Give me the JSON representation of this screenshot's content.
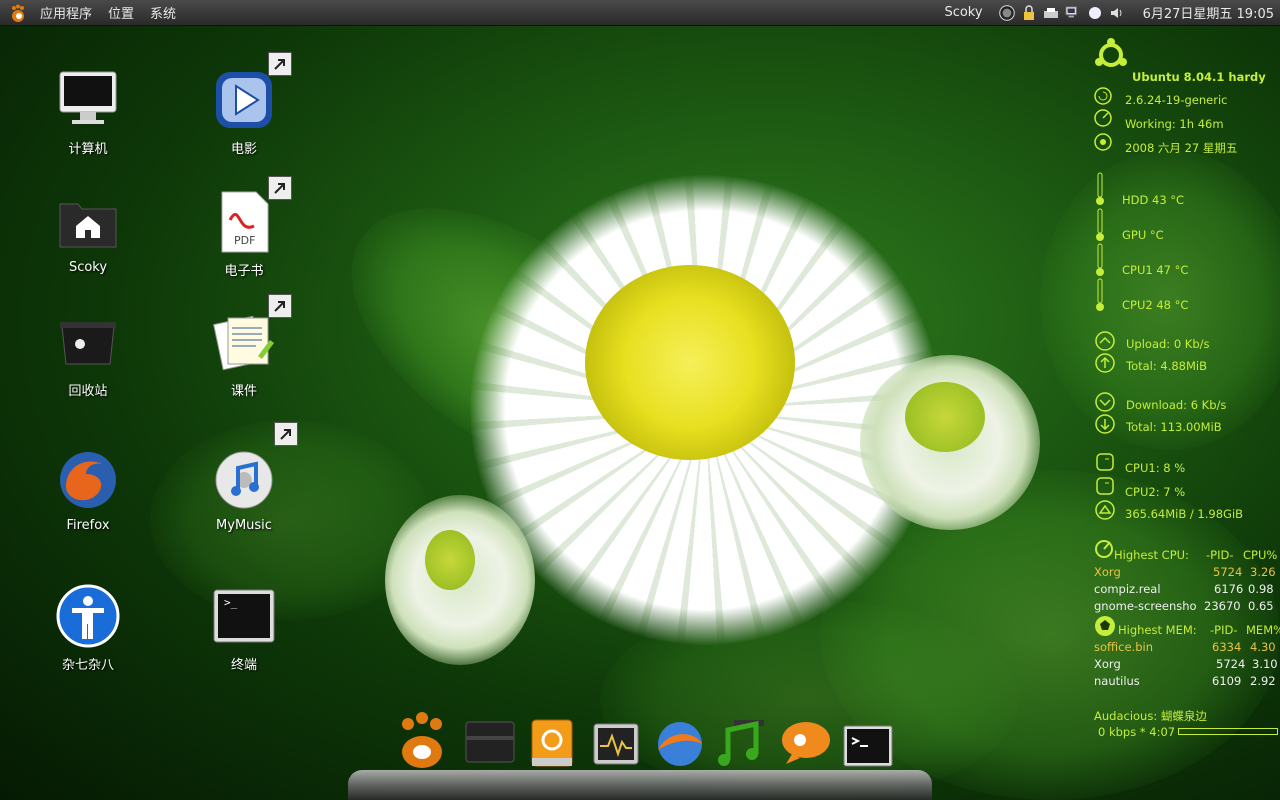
{
  "panel": {
    "menus": [
      "应用程序",
      "位置",
      "系统"
    ],
    "user": "Scoky",
    "clock": "6月27日星期五 19:05"
  },
  "desktop": {
    "icons": [
      {
        "label": "计算机"
      },
      {
        "label": "Scoky"
      },
      {
        "label": "回收站"
      },
      {
        "label": "Firefox"
      },
      {
        "label": "杂七杂八"
      },
      {
        "label": "电影"
      },
      {
        "label": "电子书"
      },
      {
        "label": "课件"
      },
      {
        "label": "MyMusic"
      },
      {
        "label": "终端"
      }
    ],
    "pdf_badge": "PDF",
    "terminal_prompt": ">_"
  },
  "conky": {
    "distro": "Ubuntu 8.04.1 hardy",
    "kernel": "2.6.24-19-generic",
    "uptime": "Working:  1h 46m",
    "date": "2008 六月 27 星期五",
    "hdd_temp": "HDD 43 °C",
    "gpu_temp": "GPU  °C",
    "cpu1_temp": "CPU1 47 °C",
    "cpu2_temp": "CPU2 48 °C",
    "upload": "Upload: 0 Kb/s",
    "upload_total": "Total: 4.88MiB",
    "download": "Download: 6 Kb/s",
    "download_total": "Total: 113.00MiB",
    "cpu1": "CPU1:  8 %",
    "cpu2": "CPU2:  7 %",
    "mem": "365.64MiB / 1.98GiB",
    "top_cpu": {
      "header": [
        "Highest CPU:",
        "-PID-",
        "CPU%"
      ],
      "rows": [
        [
          "Xorg",
          "5724",
          "3.26"
        ],
        [
          "compiz.real",
          "6176",
          "0.98"
        ],
        [
          "gnome-screensho",
          "23670",
          "0.65"
        ]
      ]
    },
    "top_mem": {
      "header": [
        "Highest MEM:",
        "-PID-",
        "MEM%"
      ],
      "rows": [
        [
          "soffice.bin",
          "6334",
          "4.30"
        ],
        [
          "Xorg",
          "5724",
          "3.10"
        ],
        [
          "nautilus",
          "6109",
          "2.92"
        ]
      ]
    },
    "audacious": "Audacious: 蝴蝶泉边",
    "audacious_rate": "0 kbps * 4:07"
  },
  "dock": {
    "items": [
      "gimp-icon",
      "folder-icon",
      "hard-drive-icon",
      "system-monitor-icon",
      "thunderbird-icon",
      "music-player-icon",
      "pidgin-icon",
      "terminal-icon"
    ]
  },
  "colors": {
    "conky_text": "#c5ee3a",
    "conky_highlight": "#e8c442",
    "panel_bg": "#3a3a3a"
  }
}
